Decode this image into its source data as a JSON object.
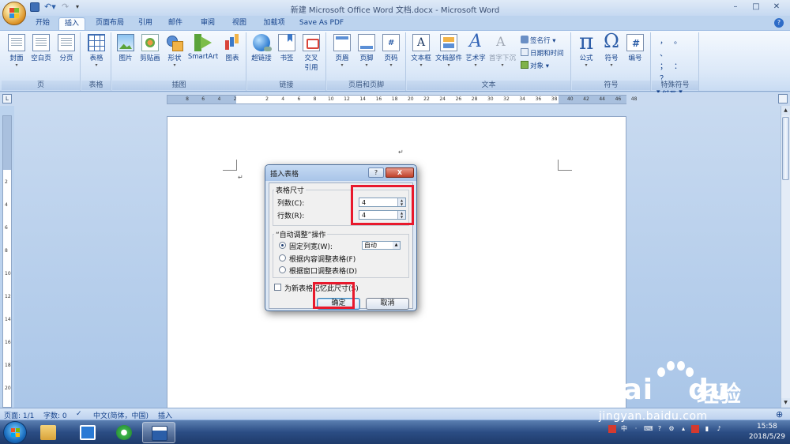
{
  "window": {
    "title": "新建 Microsoft Office Word 文档.docx - Microsoft Word",
    "controls": [
      "–",
      "□",
      "✕"
    ]
  },
  "tabs": [
    "开始",
    "插入",
    "页面布局",
    "引用",
    "邮件",
    "审阅",
    "视图",
    "加载项",
    "Save As PDF"
  ],
  "active_tab": "插入",
  "ribbon": {
    "groups": {
      "page": {
        "label": "页",
        "buttons": [
          "封面",
          "空白页",
          "分页"
        ]
      },
      "table": {
        "label": "表格",
        "buttons": [
          "表格"
        ]
      },
      "illustrations": {
        "label": "插图",
        "buttons": [
          "图片",
          "剪贴画",
          "形状",
          "SmartArt",
          "图表"
        ]
      },
      "links": {
        "label": "链接",
        "buttons": [
          "超链接",
          "书签",
          "交叉",
          "引用"
        ]
      },
      "header_footer": {
        "label": "页眉和页脚",
        "buttons": [
          "页眉",
          "页脚",
          "页码"
        ]
      },
      "text": {
        "label": "文本",
        "buttons": [
          "文本框",
          "文档部件",
          "艺术字",
          "首字下沉"
        ],
        "small": [
          "签名行",
          "日期和时间",
          "对象"
        ]
      },
      "symbols": {
        "label": "符号",
        "buttons": [
          "公式",
          "符号",
          "编号"
        ]
      },
      "special": {
        "label": "特殊符号",
        "row1": [
          "，",
          "。",
          "、"
        ],
        "row2": [
          "；",
          "：",
          "？"
        ],
        "more": "符号"
      }
    }
  },
  "ruler": {
    "ticks": [
      "8",
      "6",
      "4",
      "2",
      "2",
      "4",
      "6",
      "8",
      "10",
      "12",
      "14",
      "16",
      "18",
      "20",
      "22",
      "24",
      "26",
      "28",
      "30",
      "32",
      "34",
      "36",
      "38",
      "40",
      "42",
      "44",
      "46",
      "48"
    ],
    "vticks": [
      "2",
      "4",
      "6",
      "8",
      "10",
      "12",
      "14",
      "16",
      "18",
      "20"
    ]
  },
  "dialog": {
    "title": "插入表格",
    "help": "?",
    "close": "X",
    "size_section": "表格尺寸",
    "columns_label": "列数(C):",
    "columns_value": "4",
    "rows_label": "行数(R):",
    "rows_value": "4",
    "autofit_section": "“自动调整”操作",
    "fixed_width_label": "固定列宽(W):",
    "fixed_width_value": "自动",
    "autofit_content_label": "根据内容调整表格(F)",
    "autofit_window_label": "根据窗口调整表格(D)",
    "remember_label": "为新表格记忆此尺寸(S)",
    "ok": "确定",
    "cancel": "取消"
  },
  "statusbar": {
    "page": "页面: 1/1",
    "words": "字数: 0",
    "language": "中文(简体，中国)",
    "mode": "插入"
  },
  "taskbar": {
    "time": "15:58",
    "date": "2018/5/29",
    "ime": "中"
  },
  "watermark": {
    "brand": "Bai",
    "brand2": "du",
    "cn": "经验",
    "url": "jingyan.baidu.com"
  },
  "colors": {
    "highlight": "#e8192c",
    "ribbon_bg": "#dbe8f8",
    "taskbar": "#2b4d84"
  }
}
